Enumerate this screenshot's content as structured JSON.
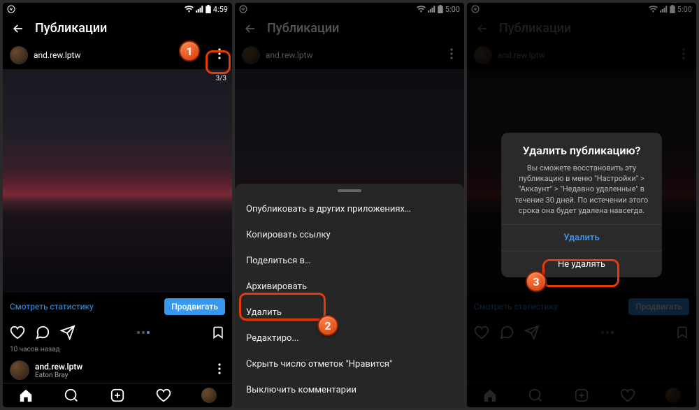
{
  "status": {
    "time1": "4:59",
    "time2": "5:00",
    "time3": "5:00"
  },
  "header": {
    "title": "Публикации"
  },
  "user": {
    "name": "and.rew.lptw"
  },
  "post": {
    "counter": "3/3",
    "view_stats": "Смотреть статистику",
    "promote": "Продвигать",
    "timestamp": "10 часов назад",
    "location": "Eaton Bray"
  },
  "sheet": {
    "share_other": "Опубликовать в других приложениях…",
    "copy_link": "Копировать ссылку",
    "share_to": "Поделиться в…",
    "archive": "Архивировать",
    "delete": "Удалить",
    "edit": "Редактиро...",
    "hide_likes": "Скрыть число отметок \"Нравится\"",
    "disable_comments": "Выключить комментарии"
  },
  "dialog": {
    "title": "Удалить публикацию?",
    "body": "Вы сможете восстановить эту публикацию в меню \"Настройки\" > \"Аккаунт\" > \"Недавно удаленные\" в течение 30 дней. По истечении этого срока она будет удалена навсегда.",
    "delete": "Удалить",
    "cancel": "Не удалять"
  },
  "callouts": {
    "c1": "1",
    "c2": "2",
    "c3": "3"
  }
}
